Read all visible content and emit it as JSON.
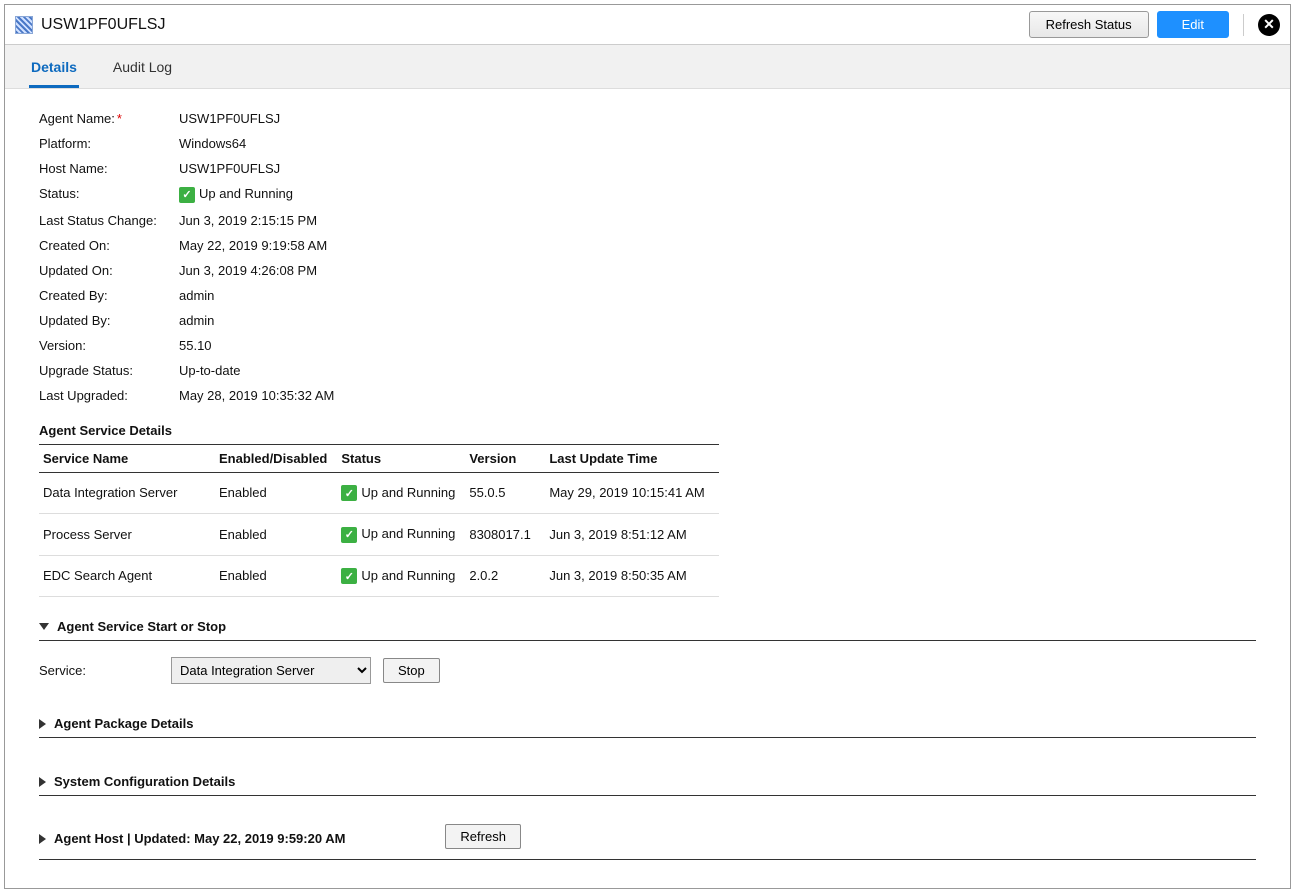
{
  "header": {
    "title": "USW1PF0UFLSJ",
    "refresh_label": "Refresh Status",
    "edit_label": "Edit"
  },
  "tabs": {
    "details": "Details",
    "audit_log": "Audit Log"
  },
  "fields": {
    "agent_name_label": "Agent Name:",
    "agent_name_value": "USW1PF0UFLSJ",
    "platform_label": "Platform:",
    "platform_value": "Windows64",
    "host_name_label": "Host Name:",
    "host_name_value": "USW1PF0UFLSJ",
    "status_label": "Status:",
    "status_value": "Up and Running",
    "last_status_change_label": "Last Status Change:",
    "last_status_change_value": "Jun 3, 2019 2:15:15 PM",
    "created_on_label": "Created On:",
    "created_on_value": "May 22, 2019 9:19:58 AM",
    "updated_on_label": "Updated On:",
    "updated_on_value": "Jun 3, 2019 4:26:08 PM",
    "created_by_label": "Created By:",
    "created_by_value": "admin",
    "updated_by_label": "Updated By:",
    "updated_by_value": "admin",
    "version_label": "Version:",
    "version_value": "55.10",
    "upgrade_status_label": "Upgrade Status:",
    "upgrade_status_value": "Up-to-date",
    "last_upgraded_label": "Last Upgraded:",
    "last_upgraded_value": "May 28, 2019 10:35:32 AM"
  },
  "svc_section_title": "Agent Service Details",
  "svc_cols": {
    "name": "Service Name",
    "enabled": "Enabled/Disabled",
    "status": "Status",
    "version": "Version",
    "last_update": "Last Update Time"
  },
  "svc_rows": [
    {
      "name": "Data Integration Server",
      "enabled": "Enabled",
      "status": "Up and Running",
      "version": "55.0.5",
      "last_update": "May 29, 2019 10:15:41 AM"
    },
    {
      "name": "Process Server",
      "enabled": "Enabled",
      "status": "Up and Running",
      "version": "8308017.1",
      "last_update": "Jun 3, 2019 8:51:12 AM"
    },
    {
      "name": "EDC Search Agent",
      "enabled": "Enabled",
      "status": "Up and Running",
      "version": "2.0.2",
      "last_update": "Jun 3, 2019 8:50:35 AM"
    }
  ],
  "sections": {
    "start_stop": "Agent Service Start or Stop",
    "service_label": "Service:",
    "service_selected": "Data Integration Server",
    "stop_label": "Stop",
    "pkg": "Agent Package Details",
    "syscfg": "System Configuration Details",
    "host_prefix": "Agent Host | Updated: ",
    "host_time": "May 22, 2019 9:59:20 AM",
    "refresh": "Refresh"
  }
}
